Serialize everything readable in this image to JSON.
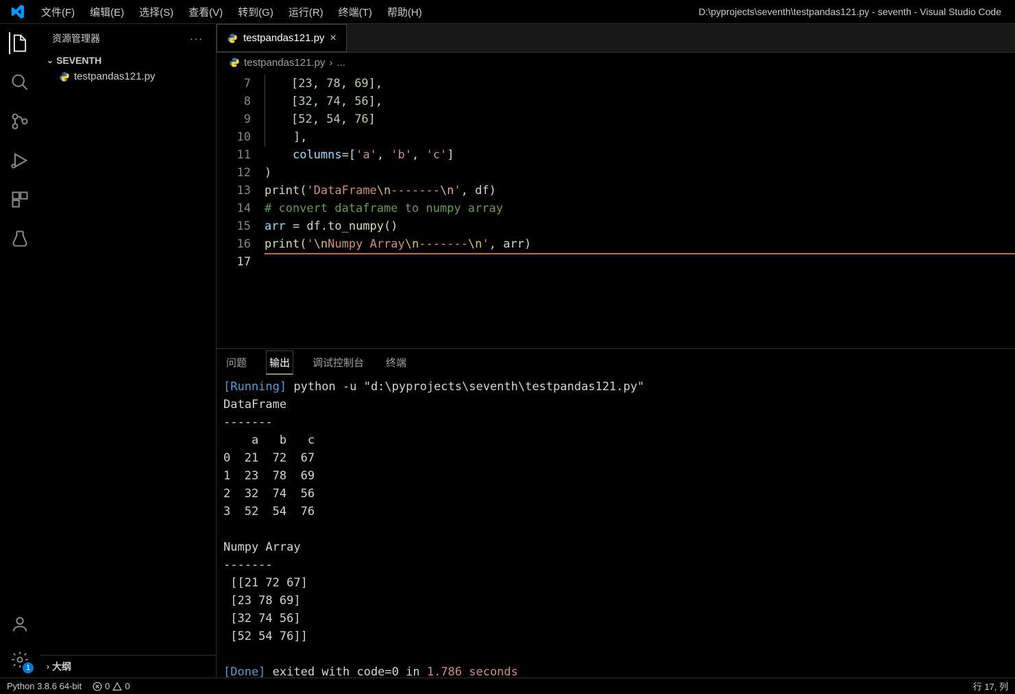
{
  "titlebar": {
    "title": "D:\\pyprojects\\seventh\\testpandas121.py - seventh - Visual Studio Code",
    "menu": [
      "文件(F)",
      "编辑(E)",
      "选择(S)",
      "查看(V)",
      "转到(G)",
      "运行(R)",
      "终端(T)",
      "帮助(H)"
    ]
  },
  "sidebar": {
    "title": "资源管理器",
    "section": "SEVENTH",
    "file": "testpandas121.py",
    "outline": "大纲"
  },
  "tab": {
    "name": "testpandas121.py"
  },
  "breadcrumb": {
    "file": "testpandas121.py",
    "more": "..."
  },
  "code": {
    "lines": [
      {
        "n": 7,
        "tokens": [
          "           [",
          "23",
          ", ",
          "78",
          ", ",
          "69",
          "],"
        ]
      },
      {
        "n": 8,
        "tokens": [
          "           [",
          "32",
          ", ",
          "74",
          ", ",
          "56",
          "],"
        ]
      },
      {
        "n": 9,
        "tokens": [
          "           [",
          "52",
          ", ",
          "54",
          ", ",
          "76",
          "]"
        ]
      },
      {
        "n": 10,
        "text": "       ],"
      },
      {
        "n": 11,
        "columns": "       columns=['a', 'b', 'c']"
      },
      {
        "n": 12,
        "text": "   )"
      },
      {
        "n": 13,
        "print1": true
      },
      {
        "n": 14,
        "comment": "# convert dataframe to numpy array"
      },
      {
        "n": 15,
        "assign": true
      },
      {
        "n": 16,
        "print2": true
      },
      {
        "n": 17,
        "empty": true
      }
    ]
  },
  "panel": {
    "tabs": [
      "问题",
      "输出",
      "调试控制台",
      "终端"
    ],
    "activeTab": 1,
    "output": {
      "runningLabel": "[Running]",
      "runningCmd": " python -u \"d:\\pyprojects\\seventh\\testpandas121.py\"",
      "df_header": "DataFrame",
      "sep": "-------",
      "df_cols": "    a   b   c",
      "df_rows": [
        "0  21  72  67",
        "1  23  78  69",
        "2  32  74  56",
        "3  52  54  76"
      ],
      "np_header": "Numpy Array",
      "np_rows": [
        " [[21 72 67]",
        " [23 78 69]",
        " [32 74 56]",
        " [52 54 76]]"
      ],
      "doneLabel": "[Done]",
      "doneText": " exited with code=0 in ",
      "doneTime": "1.786 seconds"
    }
  },
  "statusbar": {
    "python": "Python 3.8.6 64-bit",
    "errors": "0",
    "warnings": "0",
    "position": "行 17, 列"
  }
}
